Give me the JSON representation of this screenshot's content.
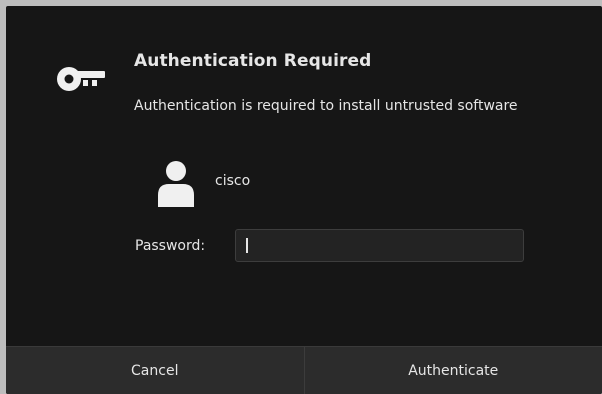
{
  "dialog": {
    "title": "Authentication Required",
    "message": "Authentication is required to install untrusted software",
    "icon": "key-icon",
    "user": {
      "avatar_icon": "user-icon",
      "name": "cisco"
    },
    "password": {
      "label": "Password:",
      "value": ""
    },
    "buttons": {
      "cancel_label": "Cancel",
      "authenticate_label": "Authenticate"
    }
  },
  "colors": {
    "dialog_background": "#161616",
    "button_bar_background": "#2c2c2c",
    "text": "#e6e6e6",
    "input_background": "#232323"
  }
}
